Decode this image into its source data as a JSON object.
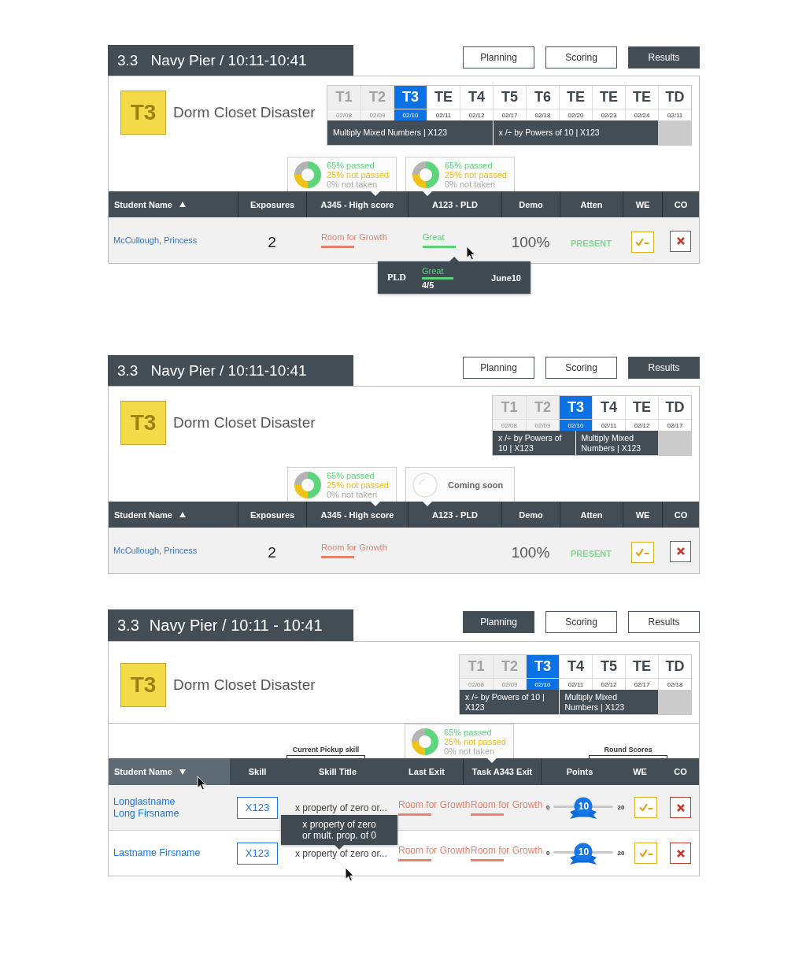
{
  "panels": [
    {
      "kind": "results",
      "number": "3.3",
      "title": "Navy Pier / 10:11-10:41",
      "buttons": [
        {
          "label": "Planning",
          "selected": false
        },
        {
          "label": "Scoring",
          "selected": false
        },
        {
          "label": "Results",
          "selected": true
        }
      ],
      "badge": "T3",
      "lesson": "Dorm Closet Disaster",
      "tasks": [
        {
          "label": "T1",
          "date": "02/08",
          "disabled": true,
          "selected": false
        },
        {
          "label": "T2",
          "date": "02/09",
          "disabled": true,
          "selected": false
        },
        {
          "label": "T3",
          "date": "02/10",
          "disabled": false,
          "selected": true
        },
        {
          "label": "TE",
          "date": "02/11",
          "disabled": false,
          "selected": false
        },
        {
          "label": "T4",
          "date": "02/12",
          "disabled": false,
          "selected": false
        },
        {
          "label": "T5",
          "date": "02/17",
          "disabled": false,
          "selected": false
        },
        {
          "label": "T6",
          "date": "02/18",
          "disabled": false,
          "selected": false
        },
        {
          "label": "TE",
          "date": "02/20",
          "disabled": false,
          "selected": false
        },
        {
          "label": "TE",
          "date": "02/23",
          "disabled": false,
          "selected": false
        },
        {
          "label": "TE",
          "date": "02/24",
          "disabled": false,
          "selected": false
        },
        {
          "label": "TD",
          "date": "02/11",
          "disabled": false,
          "selected": false
        }
      ],
      "skills": [
        "Multiply Mixed Numbers | X123",
        "x /÷ by Powers of 10 | X123"
      ],
      "table": {
        "columns": [
          {
            "label": "Student Name",
            "sorted": true,
            "descending": false
          },
          {
            "label": "Exposures",
            "sorted": false
          },
          {
            "label": "A345 - High score",
            "sorted": false,
            "popover": {
              "kind": "stats",
              "lines": [
                {
                  "text": "65% passed",
                  "kind": "passed"
                },
                {
                  "text": "25% not passed",
                  "kind": "not_passed"
                },
                {
                  "text": "0% not taken",
                  "kind": "not_taken"
                }
              ]
            }
          },
          {
            "label": "A123 - PLD",
            "sorted": false,
            "popover": {
              "kind": "stats",
              "lines": [
                {
                  "text": "65% passed",
                  "kind": "passed"
                },
                {
                  "text": "25% not passed",
                  "kind": "not_passed"
                },
                {
                  "text": "0% not taken",
                  "kind": "not_taken"
                }
              ]
            }
          },
          {
            "label": "Demo",
            "sorted": false
          },
          {
            "label": "Atten",
            "sorted": false
          },
          {
            "label": "WE",
            "sorted": false
          },
          {
            "label": "CO",
            "sorted": false
          }
        ],
        "rows": [
          {
            "cells": [
              {
                "kind": "name",
                "lines": [
                  "McCullough, Princess"
                ]
              },
              {
                "kind": "number",
                "text": "2"
              },
              {
                "kind": "rating",
                "text": "Room for Growth",
                "color": "#e8806b"
              },
              {
                "kind": "rating",
                "text": "Great",
                "color": "#5bd178",
                "tooltip": {
                  "kind": "score",
                  "label": "PLD",
                  "text": "Great",
                  "color": "#5bd178",
                  "score": "4/5",
                  "date": "June10"
                }
              },
              {
                "kind": "percent",
                "text": "100%"
              },
              {
                "kind": "status",
                "text": "PRESENT"
              },
              {
                "kind": "we"
              },
              {
                "kind": "co"
              }
            ]
          }
        ]
      }
    },
    {
      "kind": "results",
      "number": "3.3",
      "title": "Navy Pier / 10:11-10:41",
      "buttons": [
        {
          "label": "Planning",
          "selected": false
        },
        {
          "label": "Scoring",
          "selected": false
        },
        {
          "label": "Results",
          "selected": true
        }
      ],
      "badge": "T3",
      "lesson": "Dorm Closet Disaster",
      "tasks": [
        {
          "label": "T1",
          "date": "02/08",
          "disabled": true,
          "selected": false
        },
        {
          "label": "T2",
          "date": "02/09",
          "disabled": true,
          "selected": false
        },
        {
          "label": "T3",
          "date": "02/10",
          "disabled": false,
          "selected": true
        },
        {
          "label": "T4",
          "date": "02/11",
          "disabled": false,
          "selected": false
        },
        {
          "label": "TE",
          "date": "02/12",
          "disabled": false,
          "selected": false
        },
        {
          "label": "TD",
          "date": "02/17",
          "disabled": false,
          "selected": false
        }
      ],
      "skills": [
        "x /÷ by Powers of 10 | X123",
        "Multiply Mixed Numbers | X123"
      ],
      "table": {
        "columns": [
          {
            "label": "Student Name",
            "sorted": true,
            "descending": false
          },
          {
            "label": "Exposures",
            "sorted": false
          },
          {
            "label": "A345 - High score",
            "sorted": false,
            "popover": {
              "kind": "stats",
              "lines": [
                {
                  "text": "65% passed",
                  "kind": "passed"
                },
                {
                  "text": "25% not passed",
                  "kind": "not_passed"
                },
                {
                  "text": "0% not taken",
                  "kind": "not_taken"
                }
              ]
            }
          },
          {
            "label": "A123 - PLD",
            "sorted": false,
            "popover": {
              "kind": "pending",
              "text": "Coming soon"
            }
          },
          {
            "label": "Demo",
            "sorted": false
          },
          {
            "label": "Atten",
            "sorted": false
          },
          {
            "label": "WE",
            "sorted": false
          },
          {
            "label": "CO",
            "sorted": false
          }
        ],
        "rows": [
          {
            "cells": [
              {
                "kind": "name",
                "lines": [
                  "McCullough, Princess"
                ]
              },
              {
                "kind": "number",
                "text": "2"
              },
              {
                "kind": "rating",
                "text": "Room for Growth",
                "color": "#e8806b"
              },
              {
                "kind": "empty"
              },
              {
                "kind": "percent",
                "text": "100%"
              },
              {
                "kind": "status",
                "text": "PRESENT"
              },
              {
                "kind": "we"
              },
              {
                "kind": "co"
              }
            ]
          }
        ]
      }
    },
    {
      "kind": "planning",
      "number": "3.3",
      "title": "Navy Pier / 10:11 - 10:41",
      "buttons": [
        {
          "label": "Planning",
          "selected": true
        },
        {
          "label": "Scoring",
          "selected": false
        },
        {
          "label": "Results",
          "selected": false
        }
      ],
      "badge": "T3",
      "lesson": "Dorm Closet Disaster",
      "tasks": [
        {
          "label": "T1",
          "date": "02/08",
          "disabled": true,
          "selected": false
        },
        {
          "label": "T2",
          "date": "02/09",
          "disabled": true,
          "selected": false
        },
        {
          "label": "T3",
          "date": "02/10",
          "disabled": false,
          "selected": true
        },
        {
          "label": "T4",
          "date": "02/11",
          "disabled": false,
          "selected": false
        },
        {
          "label": "T5",
          "date": "02/12",
          "disabled": false,
          "selected": false
        },
        {
          "label": "TE",
          "date": "02/17",
          "disabled": false,
          "selected": false
        },
        {
          "label": "TD",
          "date": "02/18",
          "disabled": false,
          "selected": false
        }
      ],
      "skills": [
        "x /÷ by Powers of 10 | X123",
        "Multiply Mixed Numbers | X123"
      ],
      "table": {
        "columns": [
          {
            "label": "Student Name",
            "sorted": true,
            "descending": true,
            "hovered": true
          },
          {
            "label": "Skill",
            "sorted": false,
            "hovered": false
          },
          {
            "label": "Skill Title",
            "sorted": false,
            "hovered": false,
            "group": "Current Pickup skill"
          },
          {
            "label": "Last Exit",
            "sorted": false,
            "hovered": false
          },
          {
            "label": "Task A343 Exit",
            "sorted": false,
            "hovered": false,
            "popover": {
              "kind": "stats",
              "lines": [
                {
                  "text": "65% passed",
                  "kind": "passed"
                },
                {
                  "text": "25% not passed",
                  "kind": "not_passed"
                },
                {
                  "text": "0% not taken",
                  "kind": "not_taken"
                }
              ]
            }
          },
          {
            "label": "Points",
            "sorted": false,
            "hovered": false
          },
          {
            "label": "WE",
            "sorted": false,
            "hovered": false,
            "group": "Round Scores"
          },
          {
            "label": "CO",
            "sorted": false,
            "hovered": false
          }
        ],
        "rows": [
          {
            "cells": [
              {
                "kind": "name",
                "lines": [
                  "Longlastname",
                  "Long Firsname"
                ]
              },
              {
                "kind": "skill",
                "text": "X123"
              },
              {
                "kind": "title",
                "text": "x property of zero or..."
              },
              {
                "kind": "rating",
                "text": "Room for Growth",
                "color": "#e8806b"
              },
              {
                "kind": "rating",
                "text": "Room for Growth",
                "color": "#e8806b"
              },
              {
                "kind": "slider",
                "min": "0",
                "max": "20",
                "value": "10",
                "level": 0.5
              },
              {
                "kind": "we"
              },
              {
                "kind": "co"
              }
            ]
          },
          {
            "cells": [
              {
                "kind": "name",
                "lines": [
                  "Lastname Firsname"
                ]
              },
              {
                "kind": "skill",
                "text": "X123"
              },
              {
                "kind": "title",
                "text": "x property of zero or...",
                "tooltip": {
                  "kind": "text",
                  "lines": [
                    "x property of zero",
                    "or mult. prop. of 0"
                  ]
                }
              },
              {
                "kind": "rating",
                "text": "Room for Growth",
                "color": "#e8806b"
              },
              {
                "kind": "rating",
                "text": "Room for Growth",
                "color": "#e8806b"
              },
              {
                "kind": "slider",
                "min": "0",
                "max": "20",
                "value": "10",
                "level": 0.5
              },
              {
                "kind": "we"
              },
              {
                "kind": "co"
              }
            ]
          }
        ]
      }
    }
  ]
}
